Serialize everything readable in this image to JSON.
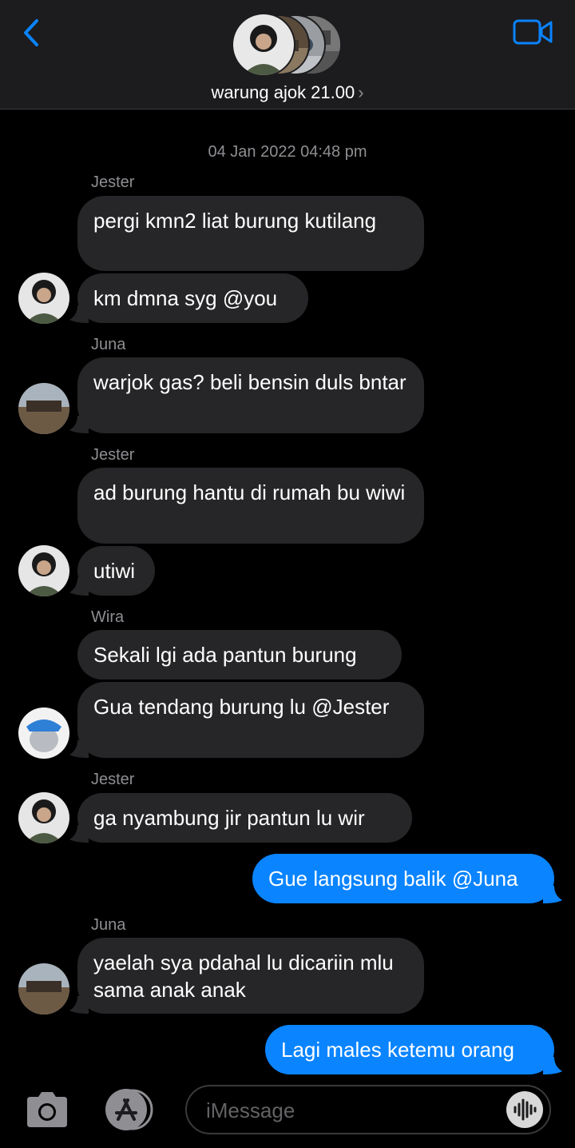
{
  "header": {
    "title": "warung ajok 21.00",
    "chevron": "›",
    "back_icon": "chevron-left-icon",
    "video_icon": "video-camera-icon",
    "accent": "#0a84ff"
  },
  "conversation": {
    "timestamp": "04 Jan 2022 04:48 pm",
    "senders": {
      "s1": "Jester",
      "s2": "Juna",
      "s3": "Jester",
      "s4": "Wira",
      "s5": "Jester",
      "s6": "Juna"
    },
    "messages": {
      "m1": "pergi kmn2 liat burung kutilang",
      "m2": "km dmna syg @you",
      "m3": "warjok gas? beli bensin duls bntar",
      "m4": "ad burung hantu di rumah bu wiwi",
      "m5": "utiwi",
      "m6": "Sekali lgi ada pantun burung",
      "m7": "Gua tendang burung lu @Jester",
      "m8": "ga nyambung jir pantun lu wir",
      "m9": "Gue langsung balik @Juna",
      "m10": "yaelah sya pdahal lu dicariin mlu sama anak anak",
      "m11": "Lagi males ketemu orang"
    }
  },
  "input": {
    "placeholder": "iMessage",
    "camera_icon": "camera-icon",
    "apps_icon": "app-store-icon",
    "audio_icon": "audio-waveform-icon"
  }
}
